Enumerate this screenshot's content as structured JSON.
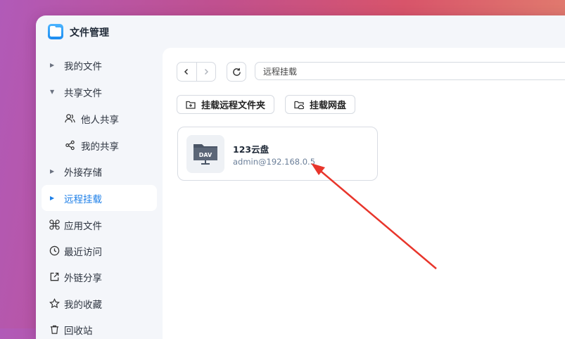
{
  "app": {
    "title": "文件管理"
  },
  "sidebar": {
    "items": [
      {
        "label": "我的文件",
        "icon": "caret-right-icon"
      },
      {
        "label": "共享文件",
        "icon": "caret-down-icon"
      },
      {
        "label": "他人共享",
        "icon": "users-icon"
      },
      {
        "label": "我的共享",
        "icon": "share-icon"
      },
      {
        "label": "外接存储",
        "icon": "caret-right-icon"
      },
      {
        "label": "远程挂载",
        "icon": "caret-right-icon",
        "active": true
      },
      {
        "label": "应用文件",
        "icon": "command-icon"
      },
      {
        "label": "最近访问",
        "icon": "clock-icon"
      },
      {
        "label": "外链分享",
        "icon": "external-link-icon"
      },
      {
        "label": "我的收藏",
        "icon": "star-icon"
      },
      {
        "label": "回收站",
        "icon": "trash-icon"
      }
    ]
  },
  "toolbar": {
    "path": "远程挂载",
    "mount_remote_folder": "挂载远程文件夹",
    "mount_cloud_drive": "挂载网盘"
  },
  "mounts": [
    {
      "name": "123云盘",
      "address": "admin@192.168.0.5",
      "badge": "DAV"
    }
  ],
  "colors": {
    "accent": "#1d7fe8",
    "annotation_arrow": "#e8352b"
  }
}
